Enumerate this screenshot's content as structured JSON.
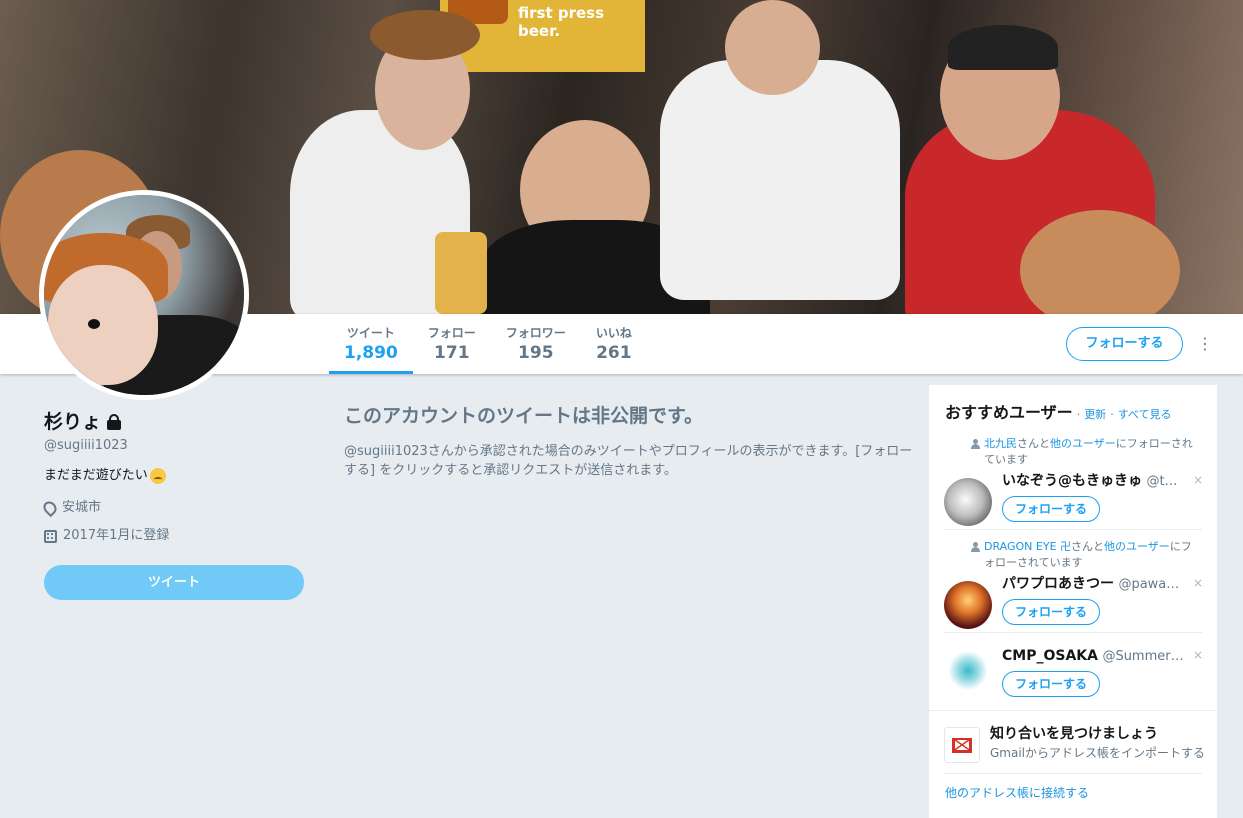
{
  "banner": {
    "poster_text": "first press beer."
  },
  "stats": [
    {
      "label": "ツイート",
      "value": "1,890"
    },
    {
      "label": "フォロー",
      "value": "171"
    },
    {
      "label": "フォロワー",
      "value": "195"
    },
    {
      "label": "いいね",
      "value": "261"
    }
  ],
  "nav": {
    "follow_label": "フォローする",
    "more_glyph": "⋮"
  },
  "profile": {
    "name": "杉りょ",
    "handle": "@sugiiii1023",
    "bio": "まだまだ遊びたい",
    "location": "安城市",
    "joined": "2017年1月に登録",
    "tweet_button": "ツイート"
  },
  "private": {
    "title": "このアカウントのツイートは非公開です。",
    "message": "@sugiiii1023さんから承認された場合のみツイートやプロフィールの表示ができます。[フォローする] をクリックすると承認リクエストが送信されます。"
  },
  "suggestions": {
    "title": "おすすめユーザー",
    "dot": "·",
    "refresh": "更新",
    "view_all": "すべて見る",
    "users": [
      {
        "ctx_link": "北九民",
        "ctx_mid": "さんと",
        "ctx_link2": "他のユーザー",
        "ctx_tail": "にフォローされています",
        "name": "いなぞう@もきゅきゅ",
        "handle": "@t…",
        "follow": "フォローする",
        "close": "×"
      },
      {
        "ctx_link": "DRAGON EYE 卍",
        "ctx_mid": "さんと",
        "ctx_link2": "他のユーザー",
        "ctx_tail": "にフォローされています",
        "name": "パワプロあきつー",
        "handle": "@pawa…",
        "follow": "フォローする",
        "close": "×"
      },
      {
        "name": "CMP_OSAKA",
        "handle": "@Summer…",
        "follow": "フォローする",
        "close": "×"
      }
    ],
    "gmail_title": "知り合いを見つけましょう",
    "gmail_sub": "Gmailからアドレス帳をインポートする",
    "other_link": "他のアドレス帳に接続する"
  }
}
